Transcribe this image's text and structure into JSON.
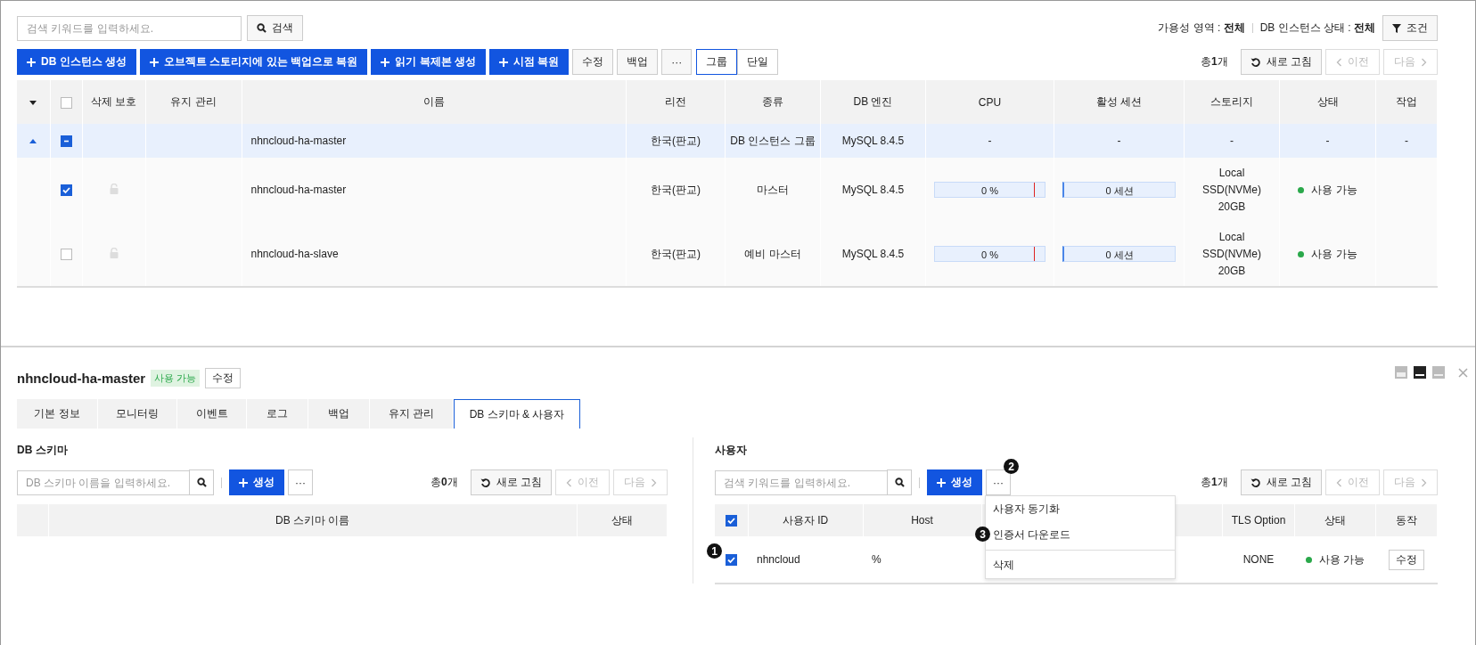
{
  "search": {
    "placeholder": "검색 키워드를 입력하세요.",
    "button": "검색"
  },
  "filters": [
    {
      "label": "가용성 영역 :",
      "value": "전체"
    },
    {
      "label": "DB 인스턴스 상태 :",
      "value": "전체"
    }
  ],
  "filter_button": "조건",
  "actions": [
    {
      "label": "DB 인스턴스 생성",
      "kind": "primary"
    },
    {
      "label": "오브젝트 스토리지에 있는 백업으로 복원",
      "kind": "primary"
    },
    {
      "label": "읽기 복제본 생성",
      "kind": "primary"
    },
    {
      "label": "시점 복원",
      "kind": "primary"
    },
    {
      "label": "수정",
      "kind": "default"
    },
    {
      "label": "백업",
      "kind": "default"
    },
    {
      "label": "···",
      "kind": "default"
    }
  ],
  "view_modes": [
    {
      "label": "그룹",
      "selected": true
    },
    {
      "label": "단일",
      "selected": false
    }
  ],
  "instances_pager": {
    "total_label": "총",
    "total": "1",
    "unit": "개",
    "refresh": "새로 고침",
    "prev": "이전",
    "next": "다음",
    "prev_disabled": true,
    "next_disabled": true
  },
  "instances_table": {
    "all_checked": false,
    "columns": [
      "삭제 보호",
      "유지 관리",
      "이름",
      "리전",
      "종류",
      "DB 엔진",
      "CPU",
      "활성 세션",
      "스토리지",
      "상태",
      "작업"
    ],
    "rows": [
      {
        "kind": "group",
        "expanded": true,
        "indeterminate": true,
        "name": "nhncloud-ha-master",
        "region": "한국(판교)",
        "type": "DB 인스턴스 그룹",
        "engine": "MySQL 8.4.5",
        "cpu": "-",
        "sessions": "-",
        "storage": "-",
        "status": "-",
        "action": "-"
      },
      {
        "kind": "member",
        "checked": true,
        "name": "nhncloud-ha-master",
        "region": "한국(판교)",
        "type": "마스터",
        "engine": "MySQL 8.4.5",
        "cpu": {
          "reading": "0 %",
          "level": 0
        },
        "sessions": {
          "reading": "0 세션",
          "level": 0
        },
        "storage": "Local SSD(NVMe) 20GB",
        "status": {
          "label": "사용 가능",
          "color": "#2aa84a"
        }
      },
      {
        "kind": "member",
        "checked": false,
        "name": "nhncloud-ha-slave",
        "region": "한국(판교)",
        "type": "예비 마스터",
        "engine": "MySQL 8.4.5",
        "cpu": {
          "reading": "0 %",
          "level": 0
        },
        "sessions": {
          "reading": "0 세션",
          "level": 0
        },
        "storage": "Local SSD(NVMe) 20GB",
        "status": {
          "label": "사용 가능",
          "color": "#2aa84a"
        }
      }
    ]
  },
  "detail": {
    "title": "nhncloud-ha-master",
    "badge": "사용 가능",
    "edit": "수정",
    "layouts": [
      {
        "selected": false
      },
      {
        "selected": true
      },
      {
        "selected": false
      }
    ],
    "tabs": [
      {
        "label": "기본 정보",
        "selected": false
      },
      {
        "label": "모니터링",
        "selected": false
      },
      {
        "label": "이벤트",
        "selected": false
      },
      {
        "label": "로그",
        "selected": false
      },
      {
        "label": "백업",
        "selected": false
      },
      {
        "label": "유지 관리",
        "selected": false
      },
      {
        "label": "DB 스키마 & 사용자",
        "selected": true
      }
    ]
  },
  "schema": {
    "heading": "DB 스키마",
    "search_placeholder": "DB 스키마 이름을 입력하세요.",
    "create": "생성",
    "more": "···",
    "pager": {
      "total_label": "총",
      "total": "0",
      "unit": "개",
      "refresh": "새로 고침",
      "prev": "이전",
      "next": "다음",
      "prev_disabled": true,
      "next_disabled": true
    },
    "columns": [
      "DB 스키마 이름",
      "상태"
    ]
  },
  "users": {
    "heading": "사용자",
    "search_placeholder": "검색 키워드를 입력하세요.",
    "create": "생성",
    "more": "···",
    "more_marker": "2",
    "pager": {
      "total_label": "총",
      "total": "1",
      "unit": "개",
      "refresh": "새로 고침",
      "prev": "이전",
      "next": "다음",
      "prev_disabled": true,
      "next_disabled": true
    },
    "all_checked": true,
    "columns": [
      "사용자 ID",
      "Host",
      "TLS Option",
      "상태",
      "동작"
    ],
    "rows": [
      {
        "checked": true,
        "marker": "1",
        "id": "nhncloud",
        "host": "%",
        "tls": "NONE",
        "status": {
          "label": "사용 가능",
          "color": "#2aa84a"
        },
        "action": "수정"
      }
    ],
    "menu_groups": [
      [
        {
          "label": "사용자 동기화"
        },
        {
          "label": "인증서 다운로드",
          "marker": "3"
        }
      ],
      [
        {
          "label": "삭제"
        }
      ]
    ]
  }
}
